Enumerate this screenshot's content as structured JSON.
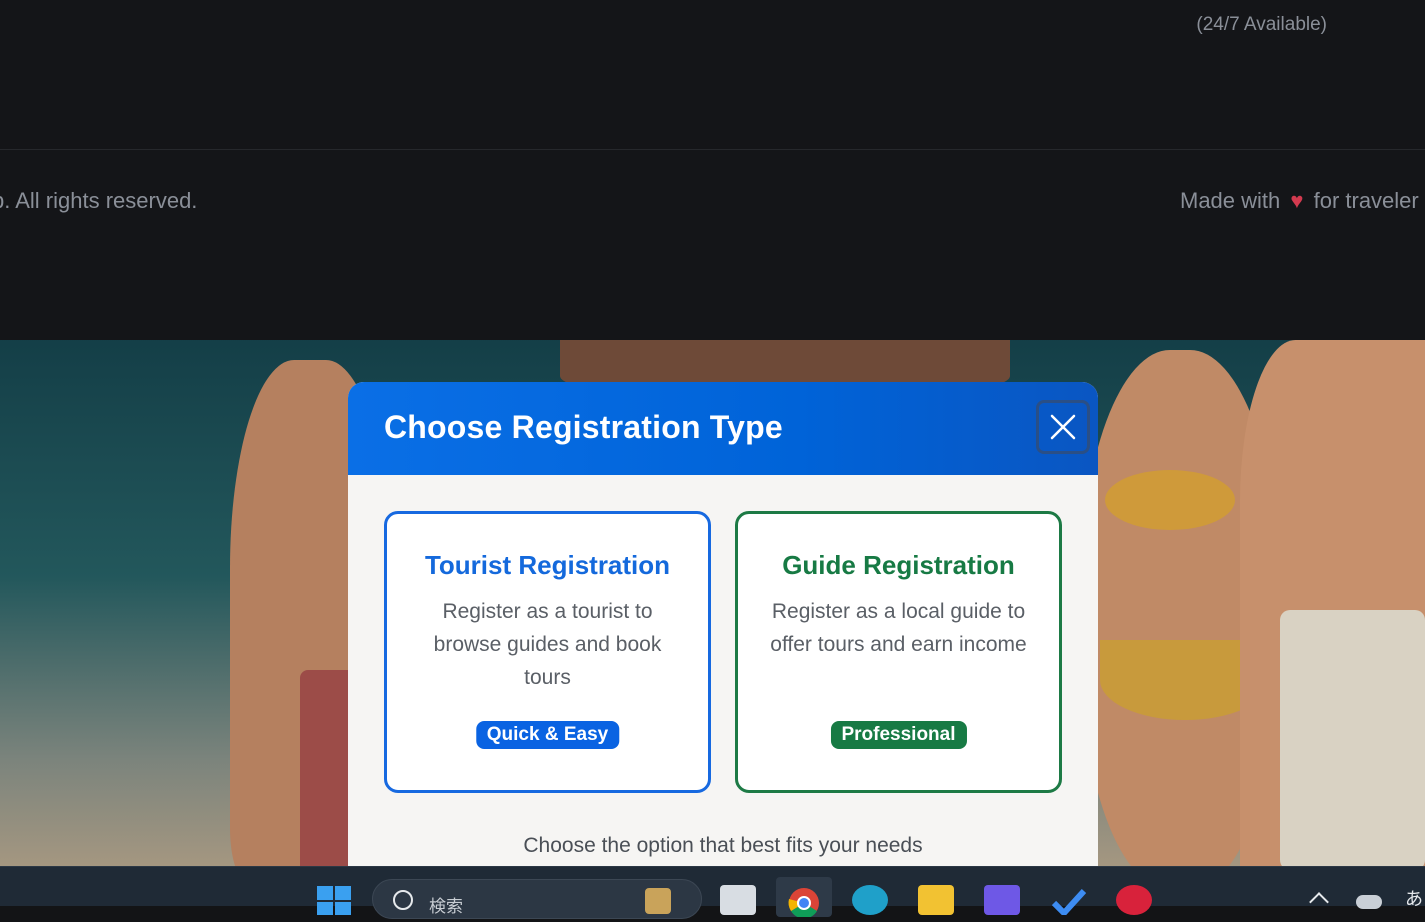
{
  "footer": {
    "availability": "(24/7 Available)",
    "copyright": "p. All rights reserved.",
    "made_with_prefix": "Made with",
    "heart_icon": "heart-icon",
    "made_with_suffix": "for traveler"
  },
  "modal": {
    "title": "Choose Registration Type",
    "close_icon": "close-icon",
    "cards": [
      {
        "title": "Tourist Registration",
        "description": "Register as a tourist to browse guides and book tours",
        "badge": "Quick & Easy",
        "accent_color": "#1769e0"
      },
      {
        "title": "Guide Registration",
        "description": "Register as a local guide to offer tours and earn income",
        "badge": "Professional",
        "accent_color": "#1d7a45"
      }
    ],
    "footer_text": "Choose the option that best fits your needs"
  },
  "taskbar": {
    "search_placeholder": "検索",
    "tray_label": "あ",
    "apps": [
      "windows-start-icon",
      "file-explorer-icon",
      "chrome-icon",
      "edge-icon",
      "folder-icon",
      "copilot-icon",
      "todo-icon",
      "pinterest-icon"
    ]
  },
  "colors": {
    "header_blue": "#0a6fe6",
    "tourist_blue": "#1469dc",
    "guide_green": "#177a44"
  }
}
